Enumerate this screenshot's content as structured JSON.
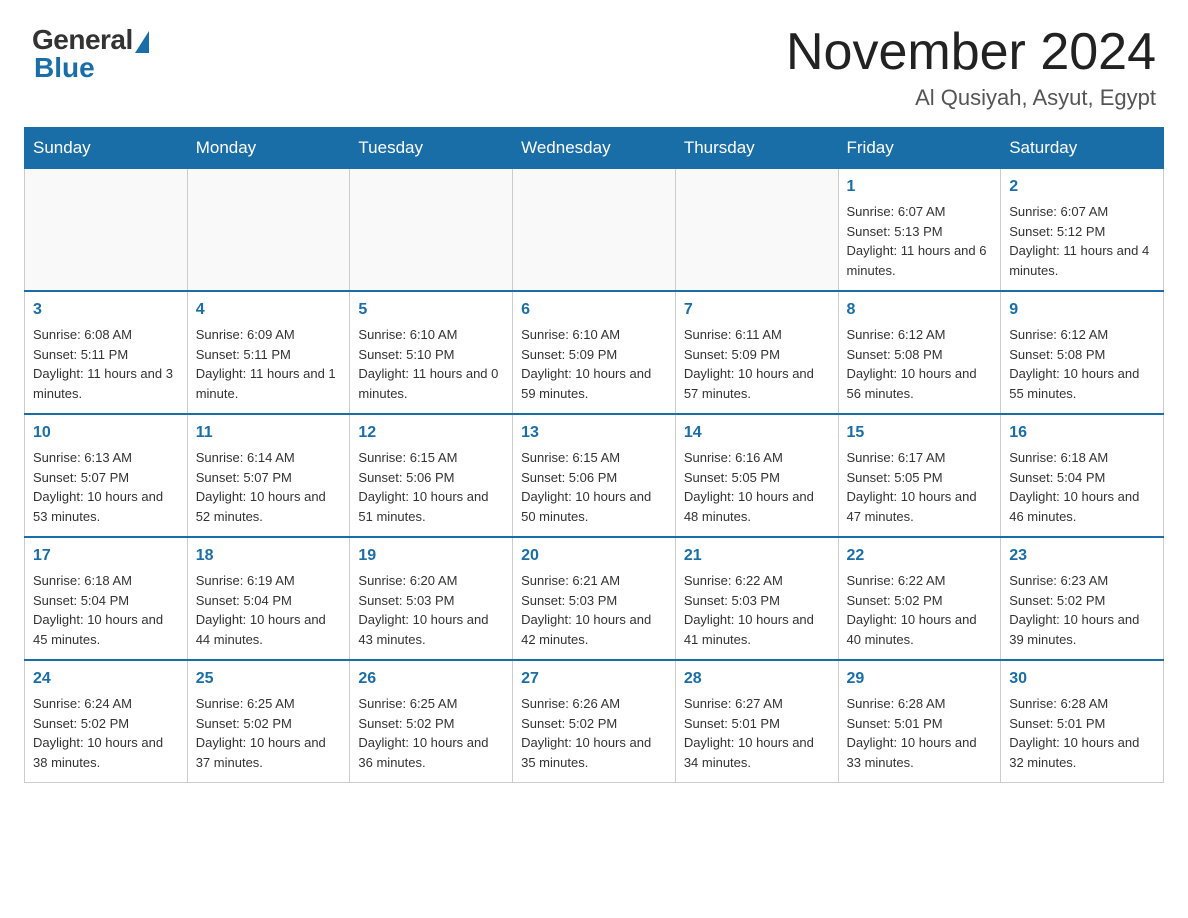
{
  "header": {
    "logo_general": "General",
    "logo_blue": "Blue",
    "month_title": "November 2024",
    "location": "Al Qusiyah, Asyut, Egypt"
  },
  "days_of_week": [
    "Sunday",
    "Monday",
    "Tuesday",
    "Wednesday",
    "Thursday",
    "Friday",
    "Saturday"
  ],
  "weeks": [
    [
      {
        "day": "",
        "data": ""
      },
      {
        "day": "",
        "data": ""
      },
      {
        "day": "",
        "data": ""
      },
      {
        "day": "",
        "data": ""
      },
      {
        "day": "",
        "data": ""
      },
      {
        "day": "1",
        "data": "Sunrise: 6:07 AM\nSunset: 5:13 PM\nDaylight: 11 hours and 6 minutes."
      },
      {
        "day": "2",
        "data": "Sunrise: 6:07 AM\nSunset: 5:12 PM\nDaylight: 11 hours and 4 minutes."
      }
    ],
    [
      {
        "day": "3",
        "data": "Sunrise: 6:08 AM\nSunset: 5:11 PM\nDaylight: 11 hours and 3 minutes."
      },
      {
        "day": "4",
        "data": "Sunrise: 6:09 AM\nSunset: 5:11 PM\nDaylight: 11 hours and 1 minute."
      },
      {
        "day": "5",
        "data": "Sunrise: 6:10 AM\nSunset: 5:10 PM\nDaylight: 11 hours and 0 minutes."
      },
      {
        "day": "6",
        "data": "Sunrise: 6:10 AM\nSunset: 5:09 PM\nDaylight: 10 hours and 59 minutes."
      },
      {
        "day": "7",
        "data": "Sunrise: 6:11 AM\nSunset: 5:09 PM\nDaylight: 10 hours and 57 minutes."
      },
      {
        "day": "8",
        "data": "Sunrise: 6:12 AM\nSunset: 5:08 PM\nDaylight: 10 hours and 56 minutes."
      },
      {
        "day": "9",
        "data": "Sunrise: 6:12 AM\nSunset: 5:08 PM\nDaylight: 10 hours and 55 minutes."
      }
    ],
    [
      {
        "day": "10",
        "data": "Sunrise: 6:13 AM\nSunset: 5:07 PM\nDaylight: 10 hours and 53 minutes."
      },
      {
        "day": "11",
        "data": "Sunrise: 6:14 AM\nSunset: 5:07 PM\nDaylight: 10 hours and 52 minutes."
      },
      {
        "day": "12",
        "data": "Sunrise: 6:15 AM\nSunset: 5:06 PM\nDaylight: 10 hours and 51 minutes."
      },
      {
        "day": "13",
        "data": "Sunrise: 6:15 AM\nSunset: 5:06 PM\nDaylight: 10 hours and 50 minutes."
      },
      {
        "day": "14",
        "data": "Sunrise: 6:16 AM\nSunset: 5:05 PM\nDaylight: 10 hours and 48 minutes."
      },
      {
        "day": "15",
        "data": "Sunrise: 6:17 AM\nSunset: 5:05 PM\nDaylight: 10 hours and 47 minutes."
      },
      {
        "day": "16",
        "data": "Sunrise: 6:18 AM\nSunset: 5:04 PM\nDaylight: 10 hours and 46 minutes."
      }
    ],
    [
      {
        "day": "17",
        "data": "Sunrise: 6:18 AM\nSunset: 5:04 PM\nDaylight: 10 hours and 45 minutes."
      },
      {
        "day": "18",
        "data": "Sunrise: 6:19 AM\nSunset: 5:04 PM\nDaylight: 10 hours and 44 minutes."
      },
      {
        "day": "19",
        "data": "Sunrise: 6:20 AM\nSunset: 5:03 PM\nDaylight: 10 hours and 43 minutes."
      },
      {
        "day": "20",
        "data": "Sunrise: 6:21 AM\nSunset: 5:03 PM\nDaylight: 10 hours and 42 minutes."
      },
      {
        "day": "21",
        "data": "Sunrise: 6:22 AM\nSunset: 5:03 PM\nDaylight: 10 hours and 41 minutes."
      },
      {
        "day": "22",
        "data": "Sunrise: 6:22 AM\nSunset: 5:02 PM\nDaylight: 10 hours and 40 minutes."
      },
      {
        "day": "23",
        "data": "Sunrise: 6:23 AM\nSunset: 5:02 PM\nDaylight: 10 hours and 39 minutes."
      }
    ],
    [
      {
        "day": "24",
        "data": "Sunrise: 6:24 AM\nSunset: 5:02 PM\nDaylight: 10 hours and 38 minutes."
      },
      {
        "day": "25",
        "data": "Sunrise: 6:25 AM\nSunset: 5:02 PM\nDaylight: 10 hours and 37 minutes."
      },
      {
        "day": "26",
        "data": "Sunrise: 6:25 AM\nSunset: 5:02 PM\nDaylight: 10 hours and 36 minutes."
      },
      {
        "day": "27",
        "data": "Sunrise: 6:26 AM\nSunset: 5:02 PM\nDaylight: 10 hours and 35 minutes."
      },
      {
        "day": "28",
        "data": "Sunrise: 6:27 AM\nSunset: 5:01 PM\nDaylight: 10 hours and 34 minutes."
      },
      {
        "day": "29",
        "data": "Sunrise: 6:28 AM\nSunset: 5:01 PM\nDaylight: 10 hours and 33 minutes."
      },
      {
        "day": "30",
        "data": "Sunrise: 6:28 AM\nSunset: 5:01 PM\nDaylight: 10 hours and 32 minutes."
      }
    ]
  ]
}
